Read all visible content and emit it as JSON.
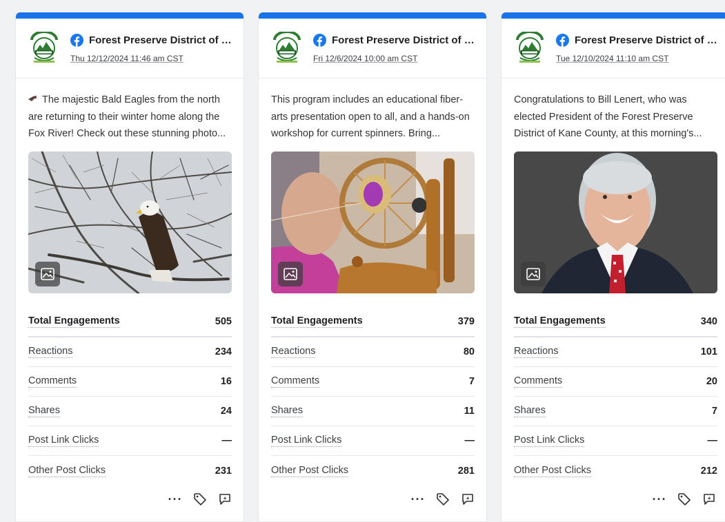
{
  "cards": [
    {
      "account": "Forest Preserve District of K...",
      "date": "Thu 12/12/2024 11:46 am CST",
      "text": "The majestic Bald Eagles from the north are returning to their winter home along the Fox River! Check out these stunning photo...",
      "has_emoji": true,
      "image_icon": "image-icon",
      "metrics": [
        {
          "label": "Total Engagements",
          "value": "505"
        },
        {
          "label": "Reactions",
          "value": "234"
        },
        {
          "label": "Comments",
          "value": "16"
        },
        {
          "label": "Shares",
          "value": "24"
        },
        {
          "label": "Post Link Clicks",
          "value": "—"
        },
        {
          "label": "Other Post Clicks",
          "value": "231"
        }
      ]
    },
    {
      "account": "Forest Preserve District of K...",
      "date": "Fri 12/6/2024 10:00 am CST",
      "text": "This program includes an educational fiber-arts presentation open to all, and a hands-on workshop for current spinners. Bring...",
      "has_emoji": false,
      "image_icon": "image-icon",
      "metrics": [
        {
          "label": "Total Engagements",
          "value": "379"
        },
        {
          "label": "Reactions",
          "value": "80"
        },
        {
          "label": "Comments",
          "value": "7"
        },
        {
          "label": "Shares",
          "value": "11"
        },
        {
          "label": "Post Link Clicks",
          "value": "—"
        },
        {
          "label": "Other Post Clicks",
          "value": "281"
        }
      ]
    },
    {
      "account": "Forest Preserve District of K...",
      "date": "Tue 12/10/2024 11:10 am CST",
      "text": "Congratulations to Bill Lenert, who was elected President of the Forest Preserve District of Kane County, at this morning's...",
      "has_emoji": false,
      "image_icon": "image-icon",
      "metrics": [
        {
          "label": "Total Engagements",
          "value": "340"
        },
        {
          "label": "Reactions",
          "value": "101"
        },
        {
          "label": "Comments",
          "value": "20"
        },
        {
          "label": "Shares",
          "value": "7"
        },
        {
          "label": "Post Link Clicks",
          "value": "—"
        },
        {
          "label": "Other Post Clicks",
          "value": "212"
        }
      ]
    }
  ],
  "colors": {
    "accent": "#1a73e8",
    "facebook": "#1877f2"
  },
  "icons": {
    "more": "more-dots-icon",
    "tag": "tag-icon",
    "boost": "boost-icon"
  }
}
